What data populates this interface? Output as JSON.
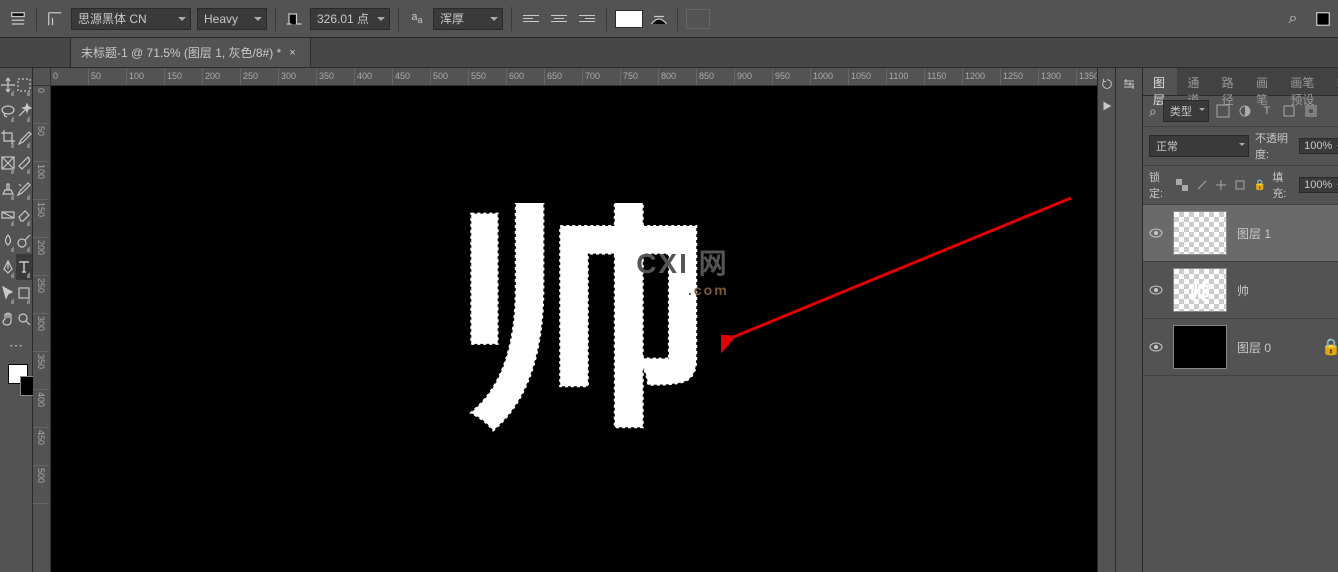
{
  "optionsBar": {
    "fontFamily": "思源黑体 CN",
    "fontWeight": "Heavy",
    "fontSize": "326.01 点",
    "antiAlias": "浑厚"
  },
  "tab": {
    "title": "未标题-1 @ 71.5% (图层 1, 灰色/8#) *",
    "close": "×"
  },
  "rulerH": [
    "0",
    "50",
    "100",
    "150",
    "200",
    "250",
    "300",
    "350",
    "400",
    "450",
    "500",
    "550",
    "600",
    "650",
    "700",
    "750",
    "800",
    "850",
    "900",
    "950",
    "1000",
    "1050",
    "1100",
    "1150",
    "1200",
    "1250",
    "1300",
    "1350"
  ],
  "rulerV": [
    "0",
    "50",
    "100",
    "150",
    "200",
    "250",
    "300",
    "350",
    "400",
    "450",
    "500"
  ],
  "panels": {
    "tabs": {
      "layers": "图层",
      "channels": "通道",
      "paths": "路径",
      "brushes": "画笔",
      "brushPresets": "画笔预设"
    },
    "filter": {
      "kindLabel": "类型"
    },
    "blend": {
      "mode": "正常",
      "opacityLabel": "不透明度:",
      "opacityVal": "100%"
    },
    "lock": {
      "label": "锁定:",
      "fillLabel": "填充:",
      "fillVal": "100%"
    },
    "layers": [
      {
        "name": "图层 1",
        "thumb": "checker",
        "selected": true,
        "locked": false
      },
      {
        "name": "帅",
        "thumb": "checker-char",
        "selected": false,
        "locked": false
      },
      {
        "name": "图层 0",
        "thumb": "black",
        "selected": false,
        "locked": true
      }
    ]
  },
  "watermark": {
    "main": "CXI 网",
    "sub": ".com"
  },
  "canvasChar": "帅",
  "icons": {
    "search": "⌕",
    "eye": "◉",
    "lock": "🔒",
    "menu": "≡"
  }
}
